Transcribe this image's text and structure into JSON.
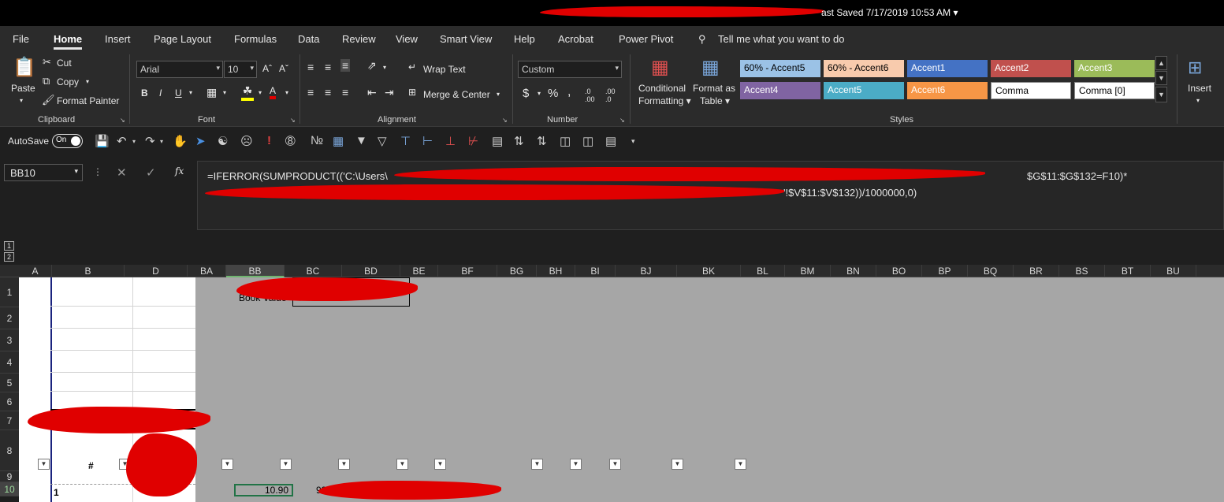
{
  "titlebar": {
    "last_saved": "ast Saved 7/17/2019 10:53 AM  ▾"
  },
  "menu": [
    "File",
    "Home",
    "Insert",
    "Page Layout",
    "Formulas",
    "Data",
    "Review",
    "View",
    "Smart View",
    "Help",
    "Acrobat",
    "Power Pivot",
    "Tell me what you want to do"
  ],
  "ribbon": {
    "clipboard": {
      "paste": "Paste",
      "cut": "Cut",
      "copy": "Copy",
      "format_painter": "Format Painter",
      "label": "Clipboard"
    },
    "font": {
      "name": "Arial",
      "size": "10",
      "label": "Font"
    },
    "alignment": {
      "wrap_text": "Wrap Text",
      "merge_center": "Merge & Center",
      "label": "Alignment"
    },
    "number": {
      "format": "Custom",
      "label": "Number"
    },
    "styles": {
      "conditional": [
        "Conditional",
        "Formatting ▾"
      ],
      "format_table": [
        "Format as",
        "Table ▾"
      ],
      "cells": [
        {
          "label": "60% - Accent5",
          "bg": "#9bc2e6",
          "fg": "#000000"
        },
        {
          "label": "60% - Accent6",
          "bg": "#f8cbad",
          "fg": "#000000"
        },
        {
          "label": "Accent1",
          "bg": "#4472c4",
          "fg": "#ffffff"
        },
        {
          "label": "Accent2",
          "bg": "#c0504d",
          "fg": "#ffffff"
        },
        {
          "label": "Accent3",
          "bg": "#9bbb59",
          "fg": "#ffffff"
        },
        {
          "label": "Accent4",
          "bg": "#8064a2",
          "fg": "#ffffff"
        },
        {
          "label": "Accent5",
          "bg": "#4bacc6",
          "fg": "#ffffff"
        },
        {
          "label": "Accent6",
          "bg": "#f79646",
          "fg": "#ffffff"
        },
        {
          "label": "Comma",
          "bg": "#ffffff",
          "fg": "#000000"
        },
        {
          "label": "Comma [0]",
          "bg": "#ffffff",
          "fg": "#000000"
        }
      ],
      "label": "Styles"
    },
    "cells_group": {
      "insert": "Insert"
    }
  },
  "qat": {
    "autosave_label": "AutoSave",
    "autosave_state": "On"
  },
  "formula_bar": {
    "name_box": "BB10",
    "formula_line1": "=IFERROR(SUMPRODUCT(('C:\\Users\\",
    "formula_line1_end": "$G$11:$G$132=F10)*",
    "formula_line2_end": "'!$V$11:$V$132))/1000000,0)"
  },
  "grid": {
    "outline_levels": [
      "1",
      "2"
    ],
    "columns": [
      "A",
      "B",
      "D",
      "BA",
      "BB",
      "BC",
      "BD",
      "BE",
      "BF",
      "BG",
      "BH",
      "BI",
      "BJ",
      "BK",
      "BL",
      "BM",
      "BN",
      "BO",
      "BP",
      "BQ",
      "BR",
      "BS",
      "BT",
      "BU"
    ],
    "rows": [
      "1",
      "2",
      "3",
      "4",
      "5",
      "6",
      "7",
      "8",
      "9",
      "10"
    ],
    "cells": {
      "bb1_label": "Book Value",
      "b8_header": "#",
      "b10": "1",
      "bb10": "10.90",
      "bc10": "99"
    }
  }
}
